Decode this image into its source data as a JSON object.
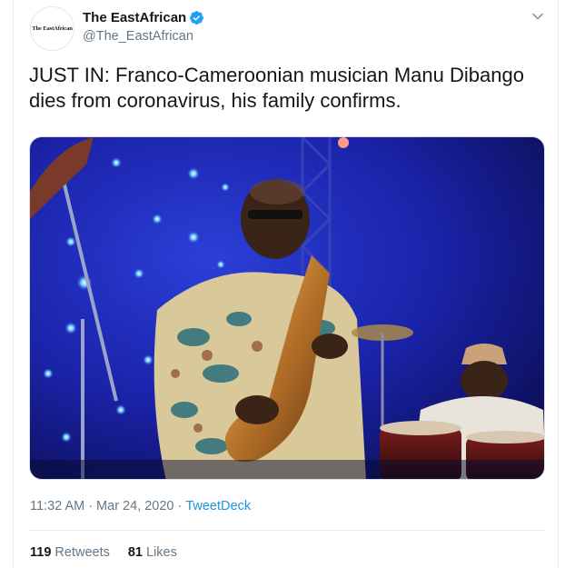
{
  "account": {
    "display_name": "The EastAfrican",
    "handle": "@The_EastAfrican",
    "avatar_text": "The EastAfrican",
    "verified": true
  },
  "tweet": {
    "text": "JUST IN: Franco-Cameroonian musician Manu Dibango dies from coronavirus, his family confirms.",
    "time": "11:32 AM",
    "separator": "·",
    "date": "Mar 24, 2020",
    "source": "TweetDeck"
  },
  "stats": {
    "retweets_count": "119",
    "retweets_label": "Retweets",
    "likes_count": "81",
    "likes_label": "Likes"
  },
  "colors": {
    "accent": "#1b95e0",
    "verified": "#1da1f2",
    "secondary_text": "#657786"
  },
  "icons": {
    "verified": "verified-badge-icon",
    "menu": "chevron-down-icon"
  }
}
